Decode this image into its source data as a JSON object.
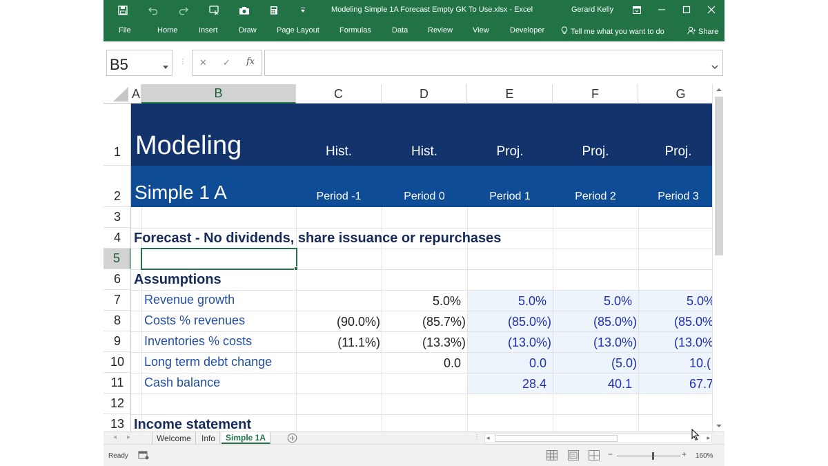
{
  "window": {
    "title": "Modeling Simple 1A Forecast Empty GK To Use.xlsx  -  Excel",
    "user": "Gerard Kelly"
  },
  "ribbon": {
    "tabs": [
      "File",
      "Home",
      "Insert",
      "Draw",
      "Page Layout",
      "Formulas",
      "Data",
      "Review",
      "View",
      "Developer"
    ],
    "tell_me": "Tell me what you want to do",
    "share": "Share"
  },
  "formula_bar": {
    "name_box": "B5",
    "fx_label": "fx",
    "value": ""
  },
  "columns": [
    "A",
    "B",
    "C",
    "D",
    "E",
    "F",
    "G"
  ],
  "rows": [
    "1",
    "2",
    "3",
    "4",
    "5",
    "6",
    "7",
    "8",
    "9",
    "10",
    "11",
    "12",
    "13"
  ],
  "sheet": {
    "title": "Modeling",
    "subtitle": "Simple 1 A",
    "hist1": "Hist.",
    "hist2": "Hist.",
    "proj1": "Proj.",
    "proj2": "Proj.",
    "proj3": "Proj.",
    "period_m1": "Period -1",
    "period_0": "Period 0",
    "period_1": "Period 1",
    "period_2": "Period 2",
    "period_3": "Period 3",
    "forecast_heading": "Forecast - No dividends, share issuance or repurchases",
    "assumptions_heading": "Assumptions",
    "income_heading": "Income statement",
    "assumptions": [
      {
        "label": "Revenue growth",
        "c": "",
        "d": "5.0%",
        "e": "5.0%",
        "f": "5.0%",
        "g": "5.0%"
      },
      {
        "label": "Costs % revenues",
        "c": "(90.0%)",
        "d": "(85.7%)",
        "e": "(85.0%)",
        "f": "(85.0%)",
        "g": "(85.0%"
      },
      {
        "label": "Inventories % costs",
        "c": "(11.1%)",
        "d": "(13.3%)",
        "e": "(13.0%)",
        "f": "(13.0%)",
        "g": "(13.0%"
      },
      {
        "label": "Long term debt change",
        "c": "",
        "d": "0.0",
        "e": "0.0",
        "f": "(5.0)",
        "g": "10.("
      },
      {
        "label": "Cash balance",
        "c": "",
        "d": "",
        "e": "28.4",
        "f": "40.1",
        "g": "67.7"
      }
    ]
  },
  "sheet_tabs": [
    "Welcome",
    "Info",
    "Simple 1A"
  ],
  "status": {
    "ready": "Ready",
    "zoom": "160%"
  },
  "colors": {
    "excel_green": "#217346",
    "header_dark": "#12336b",
    "header_mid": "#0e4d96",
    "navy_text": "#172b5a",
    "input_blue": "#1f2fb0",
    "label_blue": "#1f4e9f"
  }
}
